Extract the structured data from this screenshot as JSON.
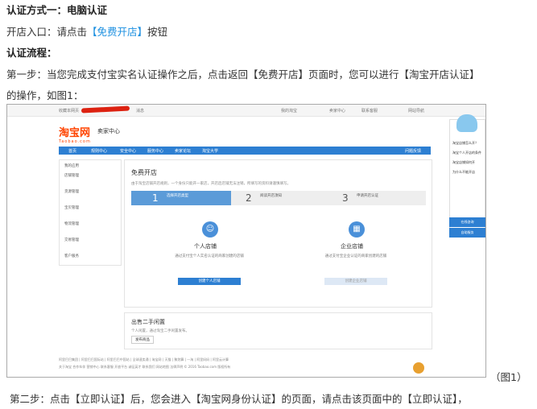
{
  "line1": "认证方式一：电脑认证",
  "line2_prefix": "开店入口：请点击",
  "line2_link": "【免费开店】",
  "line2_suffix": "按钮",
  "line3": "认证流程：",
  "line4": "第一步：当您完成支付宝实名认证操作之后，点击返回【免费开店】页面时，您可以进行【淘宝开店认证】",
  "line5": "的操作，如图1：",
  "figure_label": "（图1）",
  "line6": "第二步：点击【立即认证】后，您会进入【淘宝网身份认证】的页面，请点击该页面中的【立即认证】，",
  "screenshot": {
    "topbar": [
      "收藏本网页",
      "消息",
      "我的淘宝",
      "卖家中心",
      "联系客服",
      "网站导航"
    ],
    "logo": "淘宝网",
    "logo_sub": "Taobao.com",
    "seller_center": "卖家中心",
    "nav": [
      "首页",
      "规则中心",
      "安全中心",
      "服务中心",
      "卖家论坛",
      "淘宝大学"
    ],
    "nav_right": "问题反馈",
    "sidebar_title": "我的应用",
    "sidebar": [
      "店铺管理",
      "货源管理",
      "宝贝管理",
      "物流管理",
      "交易管理",
      "客户服务"
    ],
    "main_title": "免费开店",
    "main_desc": "由于淘宝店铺开店规则，一个身份只能开一家店，开店后店铺无法注销，所填写的资料请谨慎填写。",
    "steps": [
      {
        "num": "1",
        "label": "选择开店类型"
      },
      {
        "num": "2",
        "label": "阅读开店须知"
      },
      {
        "num": "3",
        "label": "申请开店认证"
      }
    ],
    "personal": "个人店铺",
    "personal_desc": "通过支付宝个人实名认证的商家创建的店铺",
    "personal_btn": "创建个人店铺",
    "enterprise": "企业店铺",
    "enterprise_desc": "通过支付宝企业认证的商家创建的店铺",
    "enterprise_btn": "创建企业店铺",
    "secondhand": "出售二手闲置",
    "secondhand_desc": "个人闲置，通过淘宝二手闲置发布。",
    "secondhand_btn": "发布商品",
    "footer1": "阿里巴巴集团 | 阿里巴巴国际站 | 阿里巴巴中国站 | 全球速卖通 | 淘宝网 | 天猫 | 聚划算 | 一淘 | 阿里妈妈 | 阿里云计算",
    "footer2": "关于淘宝 合作伙伴 营销中心 联系客服 开放平台 诚征英才 联系我们 网站地图 法律声明 © 2016 Taobao.com 版权所有",
    "right_panel": [
      "淘宝店铺怎么开？",
      "淘宝个人开店的条件",
      "淘宝店铺如何开",
      "为什么不能开店"
    ],
    "right_btns": [
      "在线咨询",
      "自助服务"
    ]
  }
}
